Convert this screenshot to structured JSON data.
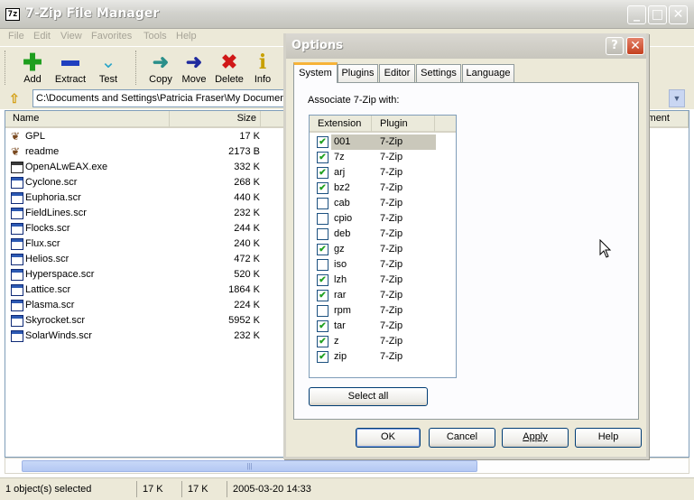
{
  "window": {
    "title": "7-Zip File Manager",
    "icon_text": "7z",
    "controls": [
      "minimize-icon",
      "maximize-icon",
      "close-icon"
    ]
  },
  "menu": [
    "File",
    "Edit",
    "View",
    "Favorites",
    "Tools",
    "Help"
  ],
  "toolbar": [
    {
      "label": "Add",
      "icon": "plus-icon",
      "color": "#1e9e1e"
    },
    {
      "label": "Extract",
      "icon": "minus-icon",
      "color": "#1f3fbf"
    },
    {
      "label": "Test",
      "icon": "check-chevron-icon",
      "color": "#2aa5c8"
    },
    {
      "label": "Copy",
      "icon": "arrow-right-icon",
      "color": "#2a8f8a"
    },
    {
      "label": "Move",
      "icon": "arrow-right-icon",
      "color": "#1f2a9e"
    },
    {
      "label": "Delete",
      "icon": "x-icon",
      "color": "#d01818"
    },
    {
      "label": "Info",
      "icon": "info-icon",
      "color": "#c8a000"
    }
  ],
  "address": {
    "path": "C:\\Documents and Settings\\Patricia Fraser\\My Documents"
  },
  "file_columns": {
    "name": "Name",
    "size": "Size",
    "comment_partial": "ment"
  },
  "files": [
    {
      "name": "GPL",
      "size": "17 K",
      "type": "txt"
    },
    {
      "name": "readme",
      "size": "2173 B",
      "type": "txt"
    },
    {
      "name": "OpenALwEAX.exe",
      "size": "332 K",
      "type": "exe"
    },
    {
      "name": "Cyclone.scr",
      "size": "268 K",
      "type": "scr"
    },
    {
      "name": "Euphoria.scr",
      "size": "440 K",
      "type": "scr"
    },
    {
      "name": "FieldLines.scr",
      "size": "232 K",
      "type": "scr"
    },
    {
      "name": "Flocks.scr",
      "size": "244 K",
      "type": "scr"
    },
    {
      "name": "Flux.scr",
      "size": "240 K",
      "type": "scr"
    },
    {
      "name": "Helios.scr",
      "size": "472 K",
      "type": "scr"
    },
    {
      "name": "Hyperspace.scr",
      "size": "520 K",
      "type": "scr"
    },
    {
      "name": "Lattice.scr",
      "size": "1864 K",
      "type": "scr"
    },
    {
      "name": "Plasma.scr",
      "size": "224 K",
      "type": "scr"
    },
    {
      "name": "Skyrocket.scr",
      "size": "5952 K",
      "type": "scr"
    },
    {
      "name": "SolarWinds.scr",
      "size": "232 K",
      "type": "scr"
    }
  ],
  "scrollbar": {
    "grip": "|||"
  },
  "status": {
    "selection": "1 object(s) selected",
    "size1": "17 K",
    "size2": "17 K",
    "modified": "2005-03-20 14:33"
  },
  "dialog": {
    "title": "Options",
    "help_glyph": "?",
    "close_glyph": "✕",
    "tabs": [
      "System",
      "Plugins",
      "Editor",
      "Settings",
      "Language"
    ],
    "active_tab": "System",
    "assoc_label": "Associate 7-Zip with:",
    "list_headers": {
      "extension": "Extension",
      "plugin": "Plugin"
    },
    "associations": [
      {
        "ext": "001",
        "plugin": "7-Zip",
        "checked": true,
        "selected": true
      },
      {
        "ext": "7z",
        "plugin": "7-Zip",
        "checked": true
      },
      {
        "ext": "arj",
        "plugin": "7-Zip",
        "checked": true
      },
      {
        "ext": "bz2",
        "plugin": "7-Zip",
        "checked": true
      },
      {
        "ext": "cab",
        "plugin": "7-Zip",
        "checked": false
      },
      {
        "ext": "cpio",
        "plugin": "7-Zip",
        "checked": false
      },
      {
        "ext": "deb",
        "plugin": "7-Zip",
        "checked": false
      },
      {
        "ext": "gz",
        "plugin": "7-Zip",
        "checked": true
      },
      {
        "ext": "iso",
        "plugin": "7-Zip",
        "checked": false
      },
      {
        "ext": "lzh",
        "plugin": "7-Zip",
        "checked": true
      },
      {
        "ext": "rar",
        "plugin": "7-Zip",
        "checked": true
      },
      {
        "ext": "rpm",
        "plugin": "7-Zip",
        "checked": false
      },
      {
        "ext": "tar",
        "plugin": "7-Zip",
        "checked": true
      },
      {
        "ext": "z",
        "plugin": "7-Zip",
        "checked": true
      },
      {
        "ext": "zip",
        "plugin": "7-Zip",
        "checked": true
      }
    ],
    "select_all": "Select all",
    "buttons": {
      "ok": "OK",
      "cancel": "Cancel",
      "apply": "Apply",
      "help": "Help"
    }
  }
}
